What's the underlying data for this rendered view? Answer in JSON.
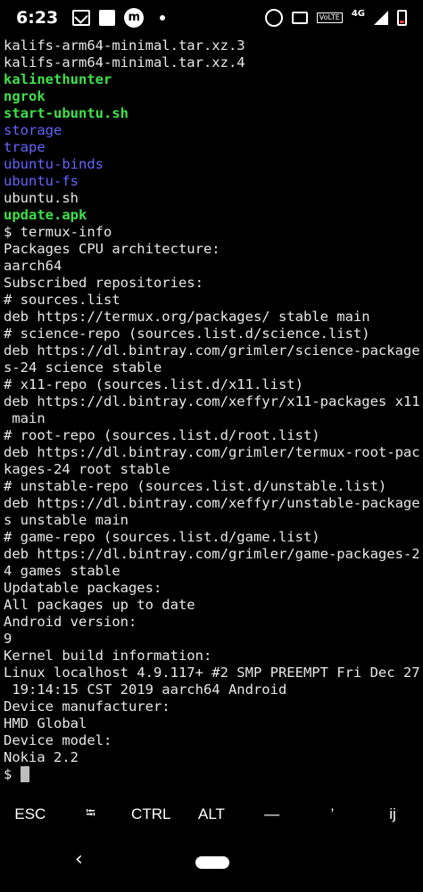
{
  "status_bar": {
    "time": "6:23",
    "volte": "VoLTE",
    "lte": "4G"
  },
  "terminal": {
    "lines": [
      {
        "text": "kalifs-arm64-minimal.tar.xz.3",
        "color": "default"
      },
      {
        "text": "kalifs-arm64-minimal.tar.xz.4",
        "color": "default"
      },
      {
        "text": "kalinethunter",
        "color": "green"
      },
      {
        "text": "ngrok",
        "color": "green"
      },
      {
        "text": "start-ubuntu.sh",
        "color": "green"
      },
      {
        "text": "storage",
        "color": "blue"
      },
      {
        "text": "trape",
        "color": "blue"
      },
      {
        "text": "ubuntu-binds",
        "color": "blue"
      },
      {
        "text": "ubuntu-fs",
        "color": "blue"
      },
      {
        "text": "ubuntu.sh",
        "color": "default"
      },
      {
        "text": "update.apk",
        "color": "green"
      },
      {
        "text": "$ termux-info",
        "color": "default"
      },
      {
        "text": "Packages CPU architecture:",
        "color": "default"
      },
      {
        "text": "aarch64",
        "color": "default"
      },
      {
        "text": "Subscribed repositories:",
        "color": "default"
      },
      {
        "text": "# sources.list",
        "color": "default"
      },
      {
        "text": "deb https://termux.org/packages/ stable main",
        "color": "default"
      },
      {
        "text": "# science-repo (sources.list.d/science.list)",
        "color": "default"
      },
      {
        "text": "deb https://dl.bintray.com/grimler/science-package",
        "color": "default"
      },
      {
        "text": "s-24 science stable",
        "color": "default"
      },
      {
        "text": "# x11-repo (sources.list.d/x11.list)",
        "color": "default"
      },
      {
        "text": "deb https://dl.bintray.com/xeffyr/x11-packages x11",
        "color": "default"
      },
      {
        "text": " main",
        "color": "default"
      },
      {
        "text": "# root-repo (sources.list.d/root.list)",
        "color": "default"
      },
      {
        "text": "deb https://dl.bintray.com/grimler/termux-root-pac",
        "color": "default"
      },
      {
        "text": "kages-24 root stable",
        "color": "default"
      },
      {
        "text": "# unstable-repo (sources.list.d/unstable.list)",
        "color": "default"
      },
      {
        "text": "deb https://dl.bintray.com/xeffyr/unstable-package",
        "color": "default"
      },
      {
        "text": "s unstable main",
        "color": "default"
      },
      {
        "text": "# game-repo (sources.list.d/game.list)",
        "color": "default"
      },
      {
        "text": "deb https://dl.bintray.com/grimler/game-packages-2",
        "color": "default"
      },
      {
        "text": "4 games stable",
        "color": "default"
      },
      {
        "text": "Updatable packages:",
        "color": "default"
      },
      {
        "text": "All packages up to date",
        "color": "default"
      },
      {
        "text": "Android version:",
        "color": "default"
      },
      {
        "text": "9",
        "color": "default"
      },
      {
        "text": "Kernel build information:",
        "color": "default"
      },
      {
        "text": "Linux localhost 4.9.117+ #2 SMP PREEMPT Fri Dec 27",
        "color": "default"
      },
      {
        "text": " 19:14:15 CST 2019 aarch64 Android",
        "color": "default"
      },
      {
        "text": "Device manufacturer:",
        "color": "default"
      },
      {
        "text": "HMD Global",
        "color": "default"
      },
      {
        "text": "Device model:",
        "color": "default"
      },
      {
        "text": "Nokia 2.2",
        "color": "default"
      }
    ],
    "prompt": "$ "
  },
  "extra_keys": {
    "esc": "ESC",
    "tab": "⭾",
    "ctrl": "CTRL",
    "alt": "ALT",
    "dash": "—",
    "quote": "’",
    "ij": "ij"
  },
  "colors": {
    "green": "#3fe04a",
    "blue": "#6464ff",
    "default": "#e8e8e8"
  }
}
